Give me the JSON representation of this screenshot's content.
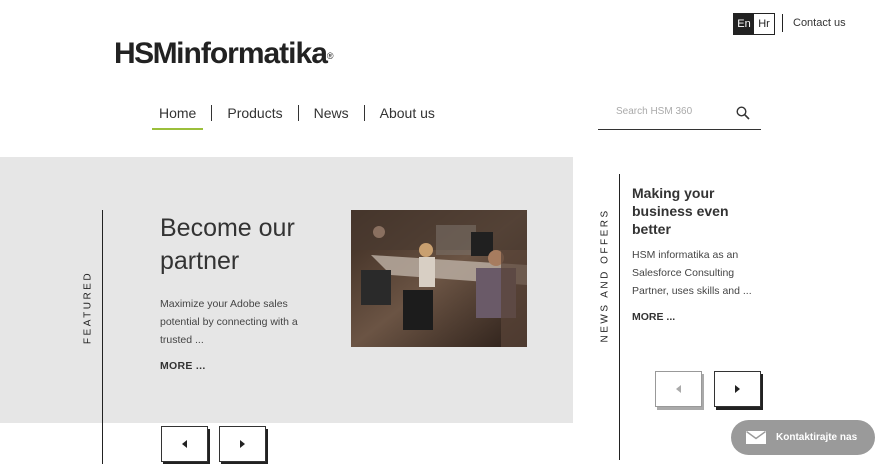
{
  "lang": {
    "active": "En",
    "other": "Hr"
  },
  "top": {
    "contact": "Contact us"
  },
  "logo": {
    "bold": "HSM",
    "rest": "informatika",
    "reg": "®"
  },
  "nav": {
    "items": [
      "Home",
      "Products",
      "News",
      "About us"
    ],
    "active": "Home"
  },
  "search": {
    "placeholder": "Search HSM 360"
  },
  "featured": {
    "label": "FEATURED",
    "headline": "Become our partner",
    "description": "Maximize your Adobe sales potential by connecting with a trusted ...",
    "more": "MORE ..."
  },
  "news": {
    "label": "NEWS AND OFFERS",
    "title": "Making your business even better",
    "body": "HSM informatika as an Salesforce Consulting Partner, uses skills and ...",
    "more": "MORE ..."
  },
  "contact_button": {
    "label": "Kontaktirajte nas"
  },
  "colors": {
    "accent": "#9bbf3b",
    "panel": "#e6e6e6",
    "pill": "#9a9a9a"
  },
  "icons": [
    "search-icon",
    "arrow-left-icon",
    "arrow-right-icon",
    "envelope-icon"
  ]
}
